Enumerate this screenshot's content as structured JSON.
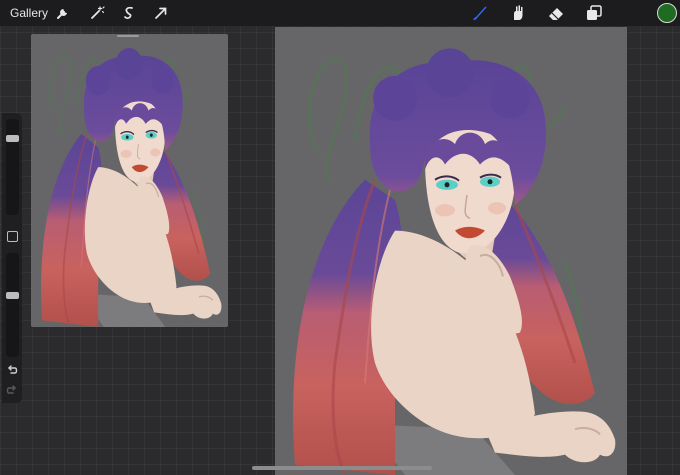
{
  "toolbar": {
    "gallery_label": "Gallery",
    "left_icons": [
      "wrench-icon",
      "magic-wand-icon",
      "selection-icon",
      "transform-arrow-icon"
    ],
    "right_icons": [
      "brush-icon",
      "smudge-icon",
      "eraser-icon",
      "layers-icon"
    ],
    "active_tool": "brush",
    "active_tool_color": "#2f6cf6",
    "current_color": "#1f6b22"
  },
  "sidebar": {
    "brush_size_level": 0.82,
    "opacity_level": 0.6,
    "icons": [
      "modify-square-icon",
      "undo-icon",
      "redo-icon"
    ]
  },
  "artwork": {
    "palette": {
      "background": "#666668",
      "hair_top": "#5b4597",
      "hair_bottom": "#c8625e",
      "skin": "#ead4c5",
      "lips": "#c24a33",
      "eyes": "#59d0c5",
      "watermark": "#4f7a4f"
    }
  }
}
